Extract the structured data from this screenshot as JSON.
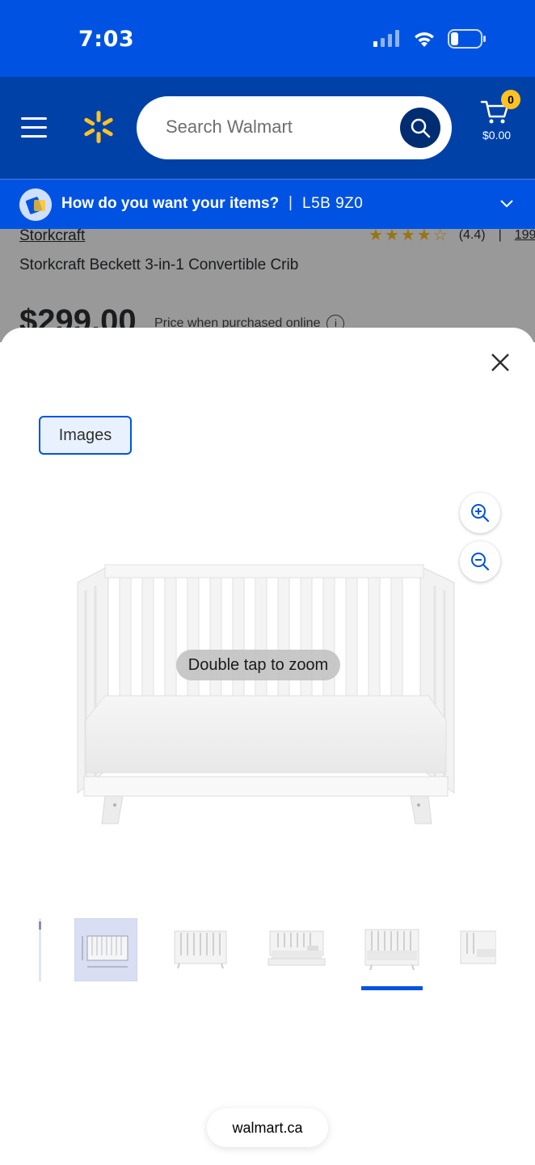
{
  "status_bar": {
    "time": "7:03"
  },
  "header": {
    "search_placeholder": "Search Walmart",
    "cart_count": "0",
    "cart_amount": "$0.00"
  },
  "delivery": {
    "question": "How do you want your items?",
    "separator": "|",
    "postal_code": "L5B 9Z0"
  },
  "product": {
    "brand": "Storkcraft",
    "rating": "(4.4)",
    "rating_separator": "|",
    "review_count": "199",
    "title": "Storkcraft Beckett 3-in-1 Convertible Crib",
    "price": "$299.00",
    "price_note": "Price when purchased online",
    "info_glyph": "i"
  },
  "viewer": {
    "tab_label": "Images",
    "zoom_hint": "Double tap to zoom",
    "thumbnails": [
      "crib-dimensions",
      "crib-front",
      "crib-daybed",
      "crib-toddler-bed",
      "crib-side"
    ],
    "selected_thumbnail_index": 4
  },
  "browser": {
    "url": "walmart.ca"
  },
  "colors": {
    "status_blue": "#0053e2",
    "header_blue": "#0041a8",
    "spark_yellow": "#ffc220",
    "accent_blue": "#0053e2"
  },
  "icons": [
    "signal-icon",
    "wifi-icon",
    "battery-icon",
    "hamburger-icon",
    "spark-logo-icon",
    "search-icon",
    "cart-icon",
    "delivery-icon",
    "chevron-down-icon",
    "info-icon",
    "close-icon",
    "zoom-in-icon",
    "zoom-out-icon"
  ]
}
